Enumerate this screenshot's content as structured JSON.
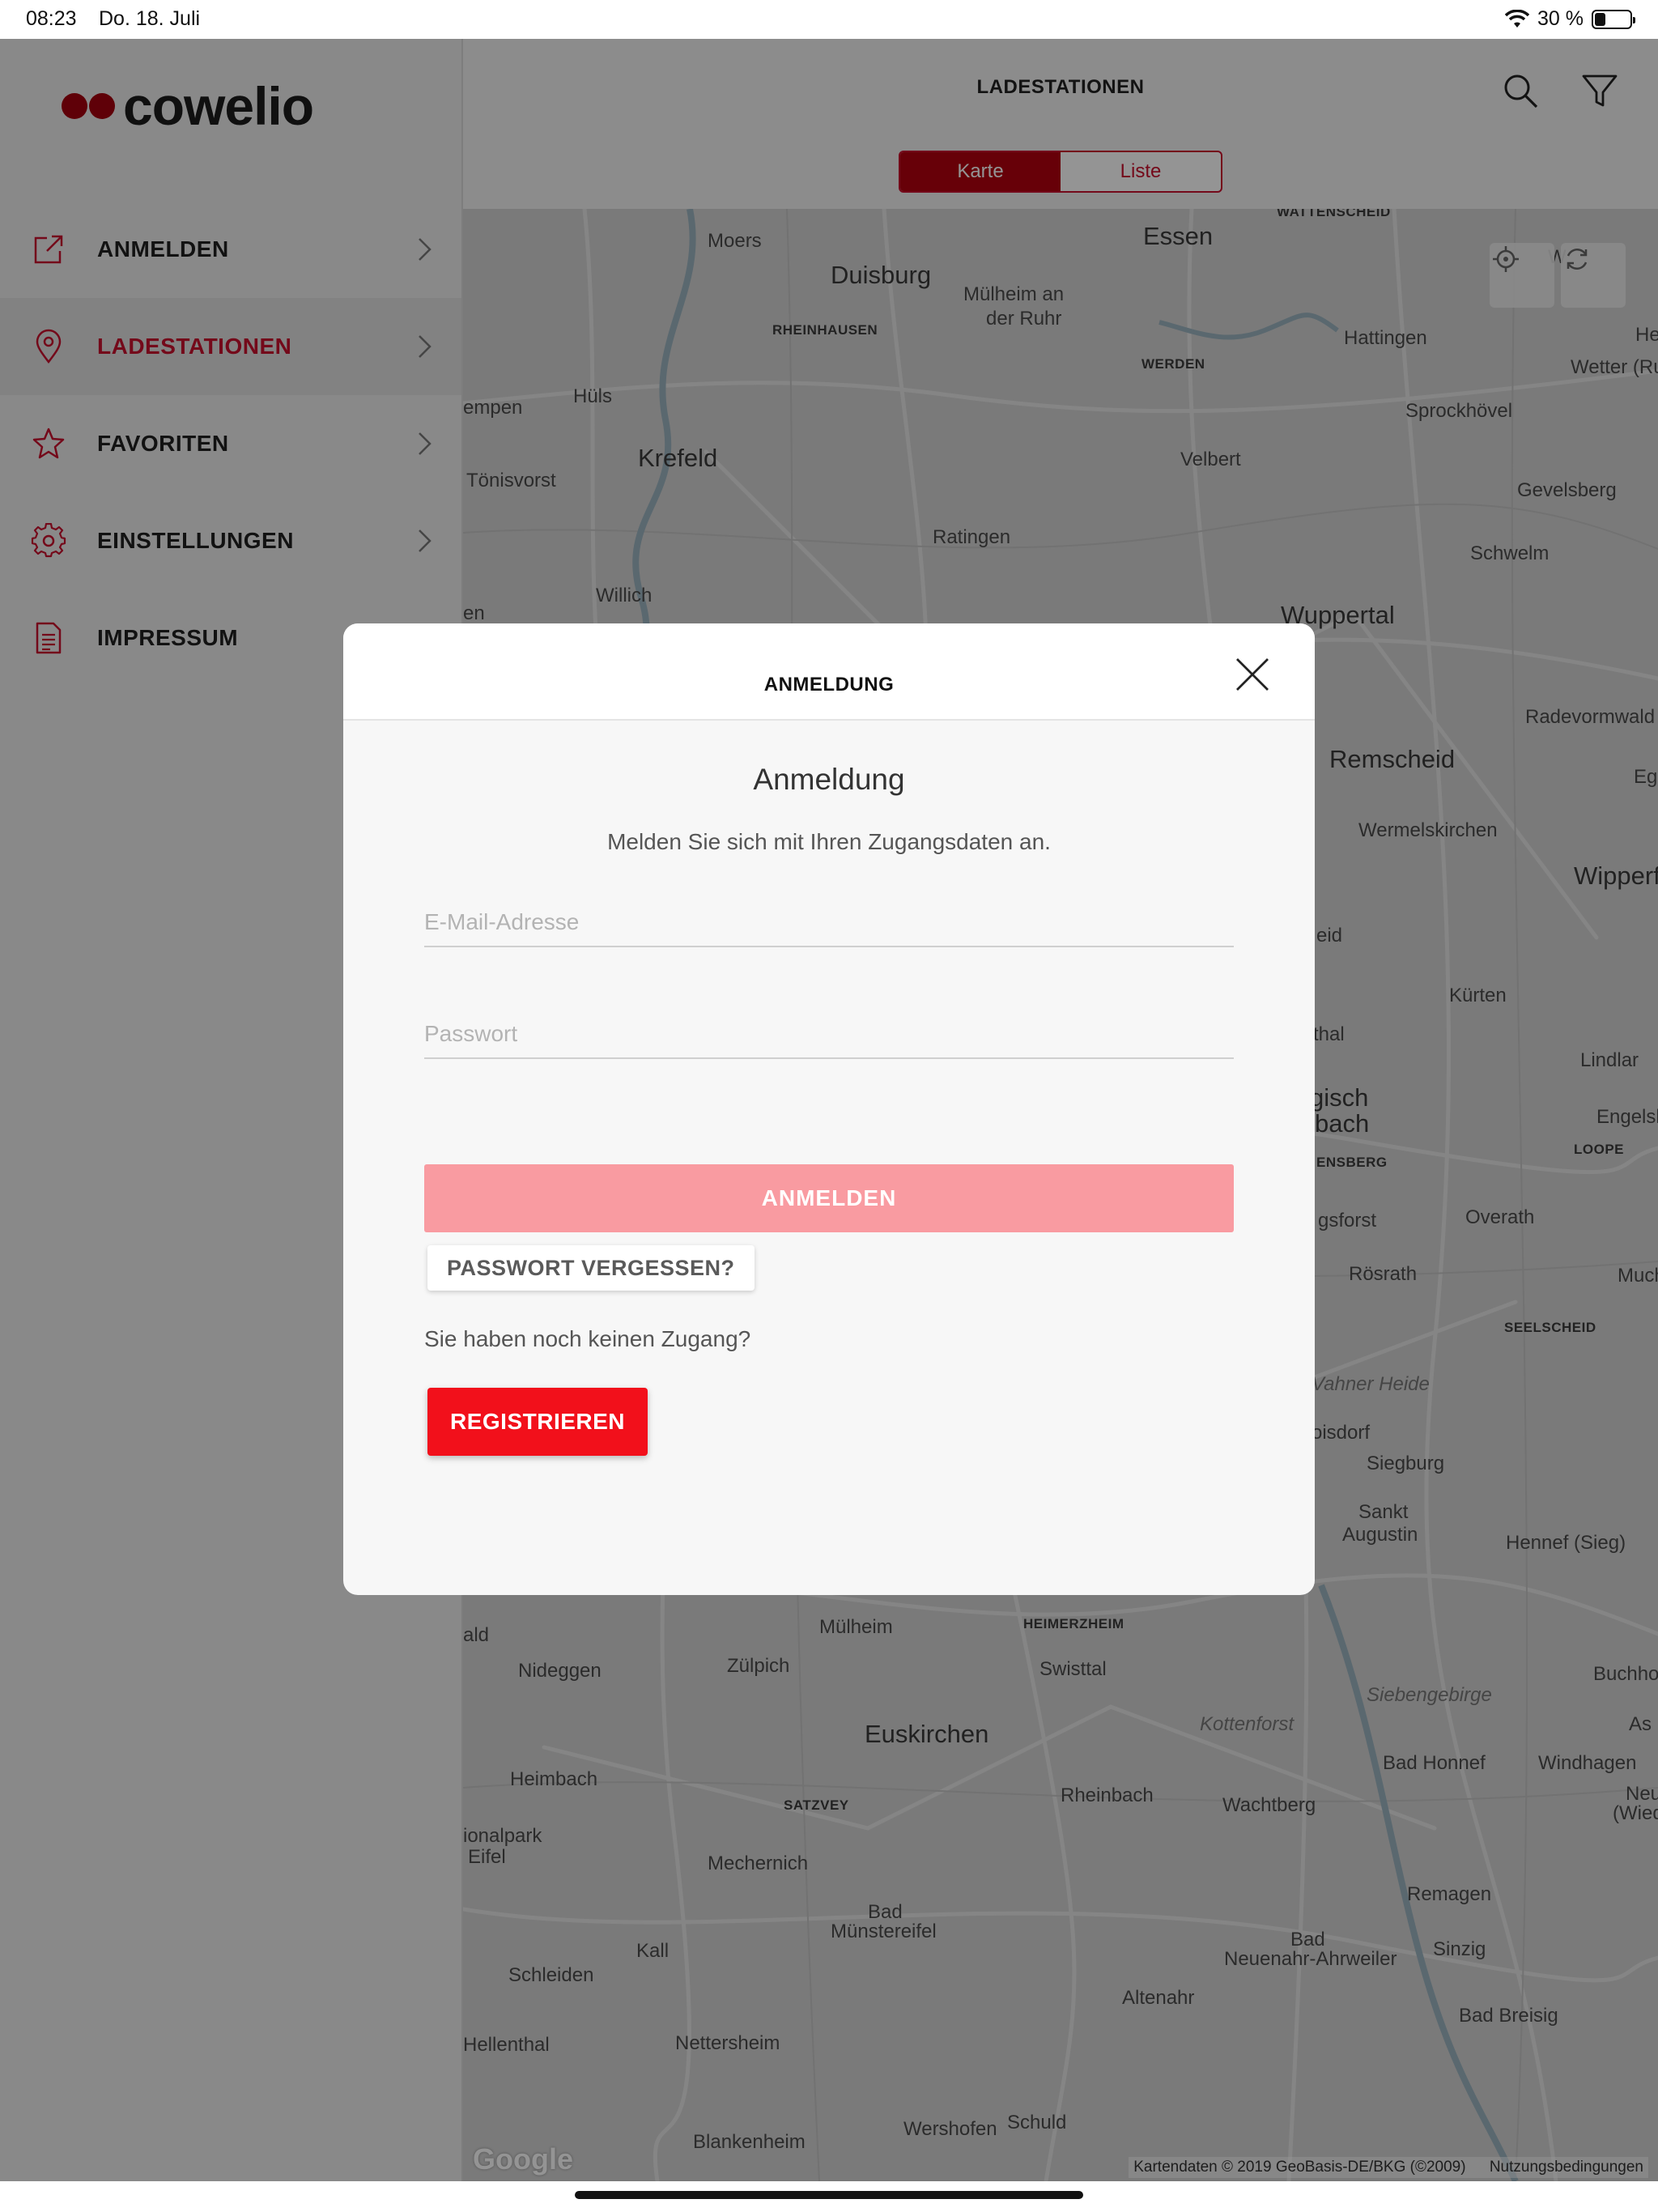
{
  "status_bar": {
    "time": "08:23",
    "date": "Do. 18. Juli",
    "battery_text": "30 %",
    "battery_level": 0.3
  },
  "sidebar": {
    "logo_text": "cowelio",
    "items": [
      {
        "label": "ANMELDEN",
        "icon": "external-link-icon",
        "active": false
      },
      {
        "label": "LADESTATIONEN",
        "icon": "map-pin-icon",
        "active": true
      },
      {
        "label": "FAVORITEN",
        "icon": "star-icon",
        "active": false
      },
      {
        "label": "EINSTELLUNGEN",
        "icon": "gear-icon",
        "active": false
      },
      {
        "label": "IMPRESSUM",
        "icon": "document-icon",
        "active": false
      }
    ]
  },
  "header": {
    "title": "LADESTATIONEN",
    "tabs": [
      {
        "label": "Karte",
        "active": true
      },
      {
        "label": "Liste",
        "active": false
      }
    ]
  },
  "map": {
    "labels": [
      "WATTENSCHEID",
      "Moers",
      "Duisburg",
      "Essen",
      "W",
      "He",
      "Mülheim an",
      "der Ruhr",
      "RHEINHAUSEN",
      "Hattingen",
      "WERDEN",
      "Wetter (Ru",
      "Hüls",
      "empen",
      "Sprockhövel",
      "Krefeld",
      "Velbert",
      "Tönisvorst",
      "Gevelsberg",
      "Ratingen",
      "Schwelm",
      "Willich",
      "Wuppertal",
      "en",
      "Radevormwald",
      "Remscheid",
      "Ege",
      "Wermelskirchen",
      "Wipperfü",
      "eid",
      "Kürten",
      "thal",
      "Lindlar",
      "gisch",
      "bach",
      "Engelsk",
      "LOOPE",
      "ENSBERG",
      "gsforst",
      "Overath",
      "Rösrath",
      "Much",
      "SEELSCHEID",
      "Vahner Heide",
      "oisdorf",
      "Siegburg",
      "Sankt",
      "Augustin",
      "Hennef (Sieg)",
      "ald",
      "Mülheim",
      "HEIMERZHEIM",
      "Nideggen",
      "Zülpich",
      "Swisttal",
      "Buchho",
      "Siebengebirge",
      "Kottenforst",
      "As",
      "Euskirchen",
      "Heimbach",
      "Bad Honnef",
      "Windhagen",
      "SATZVEY",
      "Rheinbach",
      "Wachtberg",
      "Neusta",
      "(Wied",
      "ionalpark",
      "Eifel",
      "Mechernich",
      "Remagen",
      "Bad",
      "Münstereifel",
      "Bad",
      "Neuenahr-Ahrweiler",
      "Sinzig",
      "Kall",
      "Schleiden",
      "Altenahr",
      "Bad Breisig",
      "Hellenthal",
      "Nettersheim",
      "Schuld",
      "Wershofen",
      "Blankenheim"
    ],
    "google": "Google",
    "attribution": "Kartendaten © 2019 GeoBasis-DE/BKG (©2009)",
    "terms": "Nutzungsbedingungen"
  },
  "modal": {
    "title": "ANMELDUNG",
    "heading": "Anmeldung",
    "subtitle": "Melden Sie sich mit Ihren Zugangsdaten an.",
    "email_placeholder": "E-Mail-Adresse",
    "password_placeholder": "Passwort",
    "email_value": "",
    "password_value": "",
    "login_label": "ANMELDEN",
    "forgot_label": "PASSWORT VERGESSEN?",
    "no_access_text": "Sie haben noch keinen Zugang?",
    "register_label": "REGISTRIEREN"
  },
  "colors": {
    "accent": "#c8102e",
    "tab_active": "#b1000e",
    "login_button": "#f99ba1",
    "register_button": "#f2101b",
    "logo_dots": "#a4000f"
  }
}
